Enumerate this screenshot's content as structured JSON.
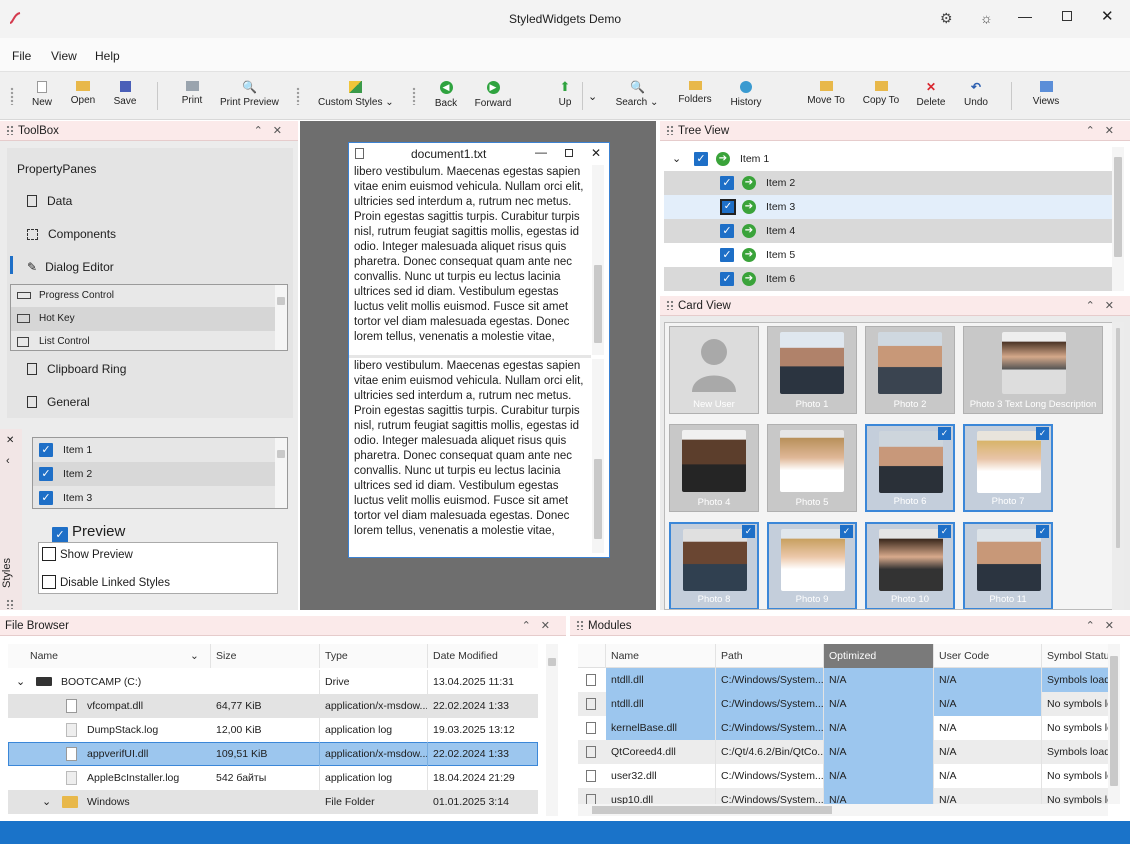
{
  "app": {
    "title": "StyledWidgets Demo"
  },
  "menu": [
    "File",
    "View",
    "Help"
  ],
  "toolbar": {
    "new": "New",
    "open": "Open",
    "save": "Save",
    "print": "Print",
    "print_preview": "Print Preview",
    "custom_styles": "Custom Styles",
    "back": "Back",
    "forward": "Forward",
    "up": "Up",
    "search": "Search",
    "folders": "Folders",
    "history": "History",
    "move_to": "Move To",
    "copy_to": "Copy To",
    "delete": "Delete",
    "undo": "Undo",
    "views": "Views"
  },
  "toolbox": {
    "title": "ToolBox",
    "section": "PropertyPanes",
    "items": [
      "Data",
      "Components",
      "Dialog Editor"
    ],
    "subitems": [
      "Progress Control",
      "Hot Key",
      "List Control"
    ],
    "items_after": [
      "Clipboard Ring",
      "General"
    ]
  },
  "styles": {
    "tab": "Styles",
    "list": [
      "Item 1",
      "Item 2",
      "Item 3"
    ],
    "preview_label": "Preview",
    "show_preview": "Show Preview",
    "disable_linked": "Disable Linked Styles"
  },
  "document": {
    "title": "document1.txt",
    "text": "libero vestibulum. Maecenas egestas sapien vitae enim euismod vehicula. Nullam orci elit, ultricies sed interdum a, rutrum nec metus. Proin egestas sagittis turpis. Curabitur turpis nisl, rutrum feugiat sagittis mollis, egestas id odio. Integer malesuada aliquet risus quis pharetra. Donec consequat quam ante nec convallis. Nunc ut turpis eu lectus lacinia ultrices sed id diam. Vestibulum egestas luctus velit mollis euismod. Fusce sit amet tortor vel diam malesuada egestas. Donec lorem tellus, venenatis a molestie vitae, porttitor ut nisl."
  },
  "tree": {
    "title": "Tree View",
    "items": [
      "Item 1",
      "Item 2",
      "Item 3",
      "Item 4",
      "Item 5",
      "Item 6"
    ]
  },
  "cards": {
    "title": "Card View",
    "items": [
      "New User",
      "Photo 1",
      "Photo 2",
      "Photo 3 Text Long  Description",
      "Photo 4",
      "Photo 5",
      "Photo 6",
      "Photo 7",
      "Photo 8",
      "Photo 9",
      "Photo 10",
      "Photo 11"
    ]
  },
  "file_browser": {
    "title": "File Browser",
    "columns": [
      "Name",
      "Size",
      "Type",
      "Date Modified"
    ],
    "rows": [
      {
        "name": "BOOTCAMP (C:)",
        "size": "",
        "type": "Drive",
        "date": "13.04.2025 11:31"
      },
      {
        "name": "vfcompat.dll",
        "size": "64,77 KiB",
        "type": "application/x-msdow...",
        "date": "22.02.2024 1:33"
      },
      {
        "name": "DumpStack.log",
        "size": "12,00 KiB",
        "type": "application log",
        "date": "19.03.2025 13:12"
      },
      {
        "name": "appverifUI.dll",
        "size": "109,51 KiB",
        "type": "application/x-msdow...",
        "date": "22.02.2024 1:33"
      },
      {
        "name": "AppleBcInstaller.log",
        "size": "542 байты",
        "type": "application log",
        "date": "18.04.2024 21:29"
      },
      {
        "name": "Windows",
        "size": "",
        "type": "File Folder",
        "date": "01.01.2025 3:14"
      }
    ]
  },
  "modules": {
    "title": "Modules",
    "columns": [
      "Name",
      "Path",
      "Optimized",
      "User Code",
      "Symbol Status"
    ],
    "rows": [
      {
        "name": "ntdll.dll",
        "path": "C:/Windows/System...",
        "opt": "N/A",
        "user": "N/A",
        "sym": "Symbols loaded"
      },
      {
        "name": "ntdll.dll",
        "path": "C:/Windows/System...",
        "opt": "N/A",
        "user": "N/A",
        "sym": "No symbols loaded"
      },
      {
        "name": "kernelBase.dll",
        "path": "C:/Windows/System...",
        "opt": "N/A",
        "user": "N/A",
        "sym": "No symbols loaded"
      },
      {
        "name": "QtCoreed4.dll",
        "path": "C:/Qt/4.6.2/Bin/QtCo...",
        "opt": "N/A",
        "user": "N/A",
        "sym": "Symbols loaded"
      },
      {
        "name": "user32.dll",
        "path": "C:/Windows/System...",
        "opt": "N/A",
        "user": "N/A",
        "sym": "No symbols loaded"
      },
      {
        "name": "usp10.dll",
        "path": "C:/Windows/System...",
        "opt": "N/A",
        "user": "N/A",
        "sym": "No symbols loaded"
      }
    ]
  },
  "colors": {
    "accent": "#1e6fc7",
    "status_bar": "#1a73c9",
    "panel_header": "#fbeaea",
    "selection": "#9cc6ee"
  }
}
